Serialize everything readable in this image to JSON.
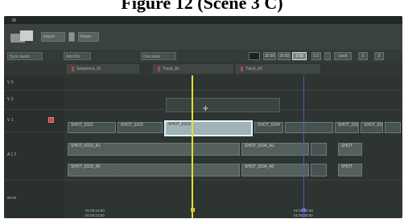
{
  "figure": {
    "title": "Figure 12 (Scene 3 C)"
  },
  "toolbar": {
    "btn_a": "Import",
    "btn_b": "Reset"
  },
  "controls": {
    "left_a": "Sync Audio",
    "left_b": "Add Bin",
    "mode_select": "Overwrite",
    "zoom_levels": [
      "10:30",
      "15:00",
      "1:00",
      "1:1",
      "Lock",
      "1",
      "2"
    ],
    "selected_zoom": "1:00"
  },
  "sequence_tabs": [
    "Sequence_01",
    "Track_A1",
    "Track_A2"
  ],
  "tracks": [
    {
      "name": "V3",
      "label": "V 3"
    },
    {
      "name": "V2",
      "label": "V 2"
    },
    {
      "name": "V1",
      "label": "V 1"
    },
    {
      "name": "A1",
      "label": "A 1 2"
    }
  ],
  "clips": {
    "v1_a": "SHOT_0101",
    "v1_b": "SHOT_0102",
    "v1_sel": "SHOT_0103",
    "v1_c": "SHOT_0104",
    "v1_d": "SHOT_0105",
    "v1_e": "SHOT_0106",
    "a1_a": "SHOT_0103_A1",
    "a1_b": "SHOT_0104_A1",
    "a1_c": "SHOT",
    "a2_a": "SHOT_0103_A2",
    "a2_b": "SHOT_0104_A2",
    "a2_c": "SHOT"
  },
  "timecodes": {
    "left_label": "00:00",
    "tc1": "01:00:10:00",
    "tc1b": "01:00:12:00",
    "tc2": "01:00:24:00",
    "tc2b": "01:00:26:00"
  },
  "colors": {
    "playhead": "#e7de37",
    "cursor": "#4a5ad0",
    "selection": "#e8f2f2"
  }
}
